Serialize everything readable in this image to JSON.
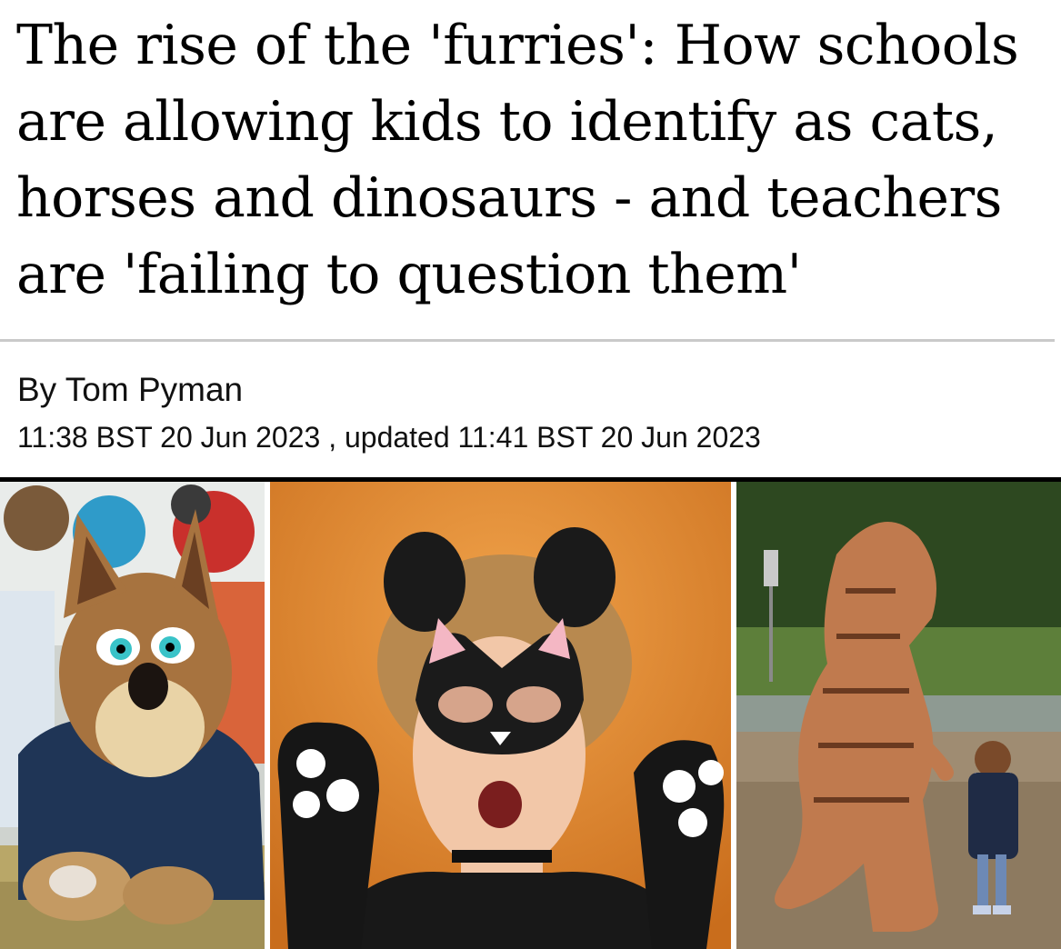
{
  "article": {
    "headline": "The rise of the 'furries': How schools are allowing kids to identify as cats, horses and dinosaurs - and teachers are 'failing to question them'",
    "byline": "By Tom Pyman",
    "dateline": "11:38 BST 20 Jun 2023 , updated 11:41 BST 20 Jun 2023"
  },
  "images": [
    {
      "name": "fox-fursuit-photo",
      "icon": "fox-costume"
    },
    {
      "name": "cat-mask-photo",
      "icon": "cat-costume"
    },
    {
      "name": "dinosaur-costume-photo",
      "icon": "t-rex-costume"
    }
  ],
  "colors": {
    "headline": "#000000",
    "rule_grey": "#c9c9c9",
    "rule_black": "#000000",
    "orange_wall": "#e08a2c"
  }
}
